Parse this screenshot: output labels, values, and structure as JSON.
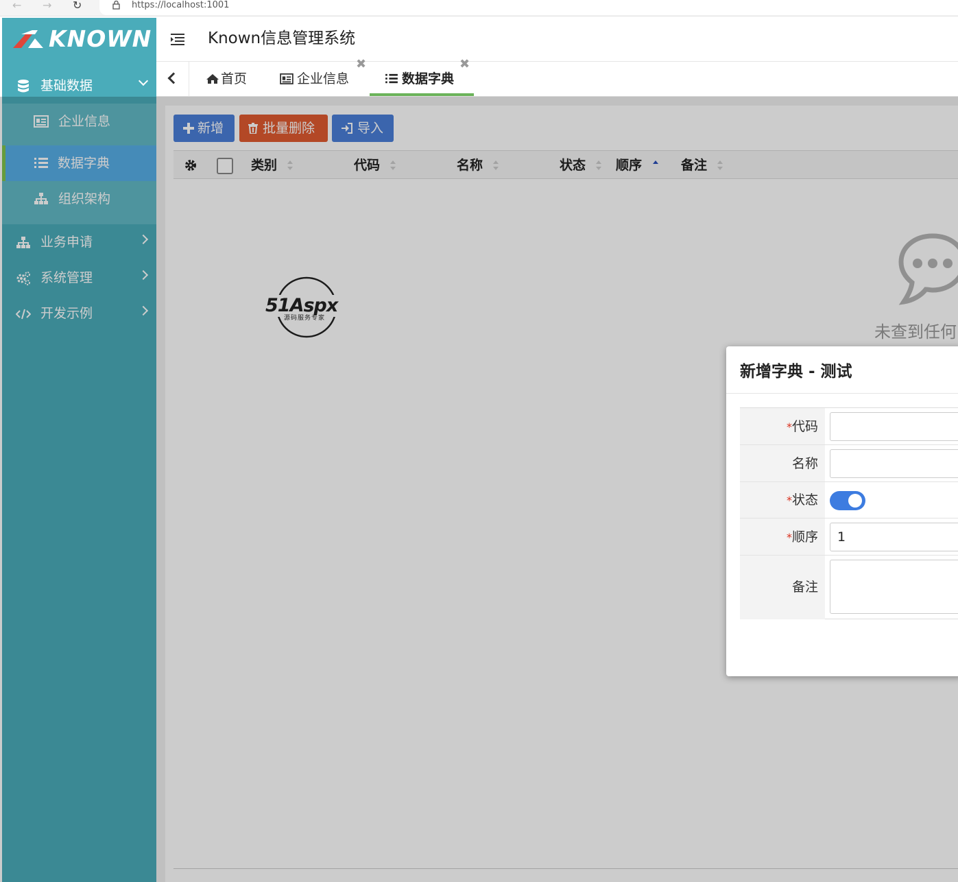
{
  "browser": {
    "url": "https://localhost:1001"
  },
  "sidebar": {
    "logo_text": "KNOWN",
    "groups": [
      {
        "label": "基础数据",
        "icon": "database-icon",
        "expanded": true
      },
      {
        "label": "业务申请",
        "icon": "sitemap-icon",
        "expanded": false
      },
      {
        "label": "系统管理",
        "icon": "gears-icon",
        "expanded": false
      },
      {
        "label": "开发示例",
        "icon": "code-icon",
        "expanded": false
      }
    ],
    "sub_items": [
      {
        "label": "企业信息",
        "icon": "id-card-icon",
        "active": false
      },
      {
        "label": "数据字典",
        "icon": "list-icon",
        "active": true
      },
      {
        "label": "组织架构",
        "icon": "sitemap-icon",
        "active": false
      }
    ]
  },
  "header": {
    "title": "Known信息管理系统"
  },
  "tabs": [
    {
      "label": "首页",
      "icon": "home-icon",
      "closable": false,
      "active": false
    },
    {
      "label": "企业信息",
      "icon": "id-card-icon",
      "closable": true,
      "active": false
    },
    {
      "label": "数据字典",
      "icon": "list-icon",
      "closable": true,
      "active": true
    }
  ],
  "toolbar": {
    "add_label": "新增",
    "batch_delete_label": "批量删除",
    "import_label": "导入"
  },
  "table": {
    "columns": [
      {
        "label": "类别",
        "sort": "none"
      },
      {
        "label": "代码",
        "sort": "none"
      },
      {
        "label": "名称",
        "sort": "none"
      },
      {
        "label": "状态",
        "sort": "none"
      },
      {
        "label": "顺序",
        "sort": "asc"
      },
      {
        "label": "备注",
        "sort": "none"
      }
    ],
    "empty_text": "未查到任何"
  },
  "watermark": {
    "brand": "51Aspx",
    "tagline": "源码服务专家"
  },
  "modal": {
    "title": "新增字典 - 测试",
    "fields": {
      "code_label": "代码",
      "code_value": "",
      "name_label": "名称",
      "name_value": "",
      "status_label": "状态",
      "status_on": true,
      "order_label": "顺序",
      "order_value": "1",
      "note_label": "备注",
      "note_value": ""
    },
    "required_mark": "*"
  },
  "colors": {
    "sidebar_bg": "#4aacba",
    "submenu_bg": "#62bac6",
    "active_item_bg": "#57aee7",
    "active_tab_underline": "#6bb35a",
    "primary_button": "#4a7fd9",
    "danger_button": "#e05a30"
  }
}
